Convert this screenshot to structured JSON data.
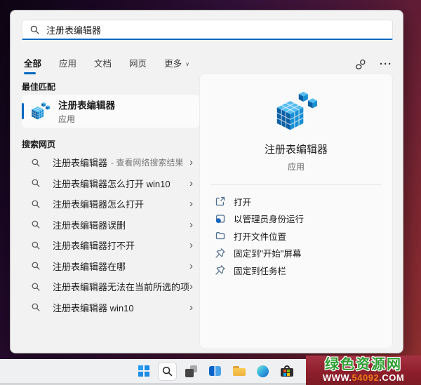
{
  "search_box": {
    "value": "注册表编辑器"
  },
  "tabs": {
    "items": [
      {
        "label": "全部",
        "active": true,
        "chevron": false
      },
      {
        "label": "应用",
        "active": false,
        "chevron": false
      },
      {
        "label": "文档",
        "active": false,
        "chevron": false
      },
      {
        "label": "网页",
        "active": false,
        "chevron": false
      },
      {
        "label": "更多",
        "active": false,
        "chevron": true
      }
    ]
  },
  "header_actions": {
    "signin_icon": "sign-in-options-icon",
    "more_icon": "more-options-icon",
    "more_glyph": "···"
  },
  "left_panel": {
    "best_match_heading": "最佳匹配",
    "best_match": {
      "title": "注册表编辑器",
      "subtitle": "应用",
      "icon": "registry-icon"
    },
    "web_search_heading": "搜索网页",
    "suggestions": [
      {
        "text": "注册表编辑器",
        "suffix": "- 查看网络搜索结果"
      },
      {
        "text": "注册表编辑器怎么打开 win10",
        "suffix": ""
      },
      {
        "text": "注册表编辑器怎么打开",
        "suffix": ""
      },
      {
        "text": "注册表编辑器误删",
        "suffix": ""
      },
      {
        "text": "注册表编辑器打不开",
        "suffix": ""
      },
      {
        "text": "注册表编辑器在哪",
        "suffix": ""
      },
      {
        "text": "注册表编辑器无法在当前所选的项",
        "suffix": ""
      },
      {
        "text": "注册表编辑器 win10",
        "suffix": ""
      }
    ]
  },
  "detail_panel": {
    "app_title": "注册表编辑器",
    "app_subtitle": "应用",
    "app_icon": "registry-icon",
    "actions": [
      {
        "icon": "open-external-icon",
        "label": "打开"
      },
      {
        "icon": "run-as-admin-icon",
        "label": "以管理员身份运行"
      },
      {
        "icon": "folder-icon",
        "label": "打开文件位置"
      },
      {
        "icon": "pin-start-icon",
        "label": "固定到\"开始\"屏幕"
      },
      {
        "icon": "pin-taskbar-icon",
        "label": "固定到任务栏"
      }
    ]
  },
  "taskbar": {
    "icons": [
      "start-icon",
      "search-taskbar-icon",
      "task-view-icon",
      "widgets-icon",
      "file-explorer-icon",
      "edge-icon",
      "store-icon"
    ],
    "active_icon": "search-taskbar-icon"
  },
  "watermark": {
    "site_name": "绿色资源网",
    "url_prefix": "WWW.",
    "url_number": "54092",
    "url_suffix": ".COM"
  },
  "colors": {
    "accent": "#0067c0",
    "watermark_green": "#2f9e33",
    "watermark_orange": "#f07818",
    "taskbar_bg": "#eff0f2"
  }
}
